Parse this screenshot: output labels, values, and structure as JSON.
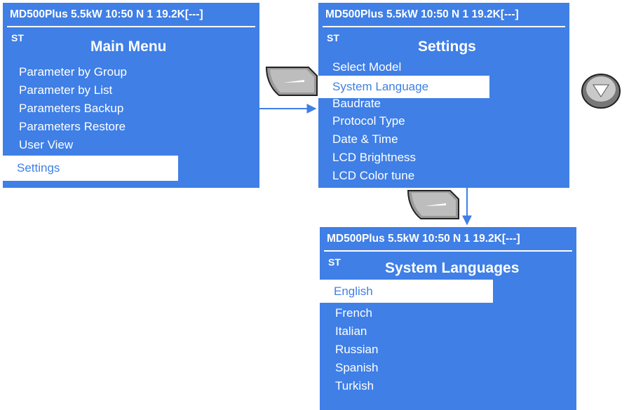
{
  "status_bar": "MD500Plus  5.5kW  10:50  N  1 19.2K[---]",
  "state": "ST",
  "colors": {
    "screen_bg": "#3f7fe6",
    "text": "#ffffff",
    "highlight_bg": "#ffffff",
    "highlight_text": "#3f7fe6"
  },
  "main_menu": {
    "title": "Main Menu",
    "items": [
      "Parameter by Group",
      "Parameter by List",
      "Parameters Backup",
      "Parameters Restore",
      "User View"
    ],
    "selected": "Settings"
  },
  "settings": {
    "title": "Settings",
    "item_top": "Select Model",
    "selected": "System Language",
    "items_below": [
      "Baudrate",
      "Protocol Type",
      "Date & Time",
      "LCD Brightness",
      "LCD Color tune"
    ]
  },
  "languages": {
    "title": "System Languages",
    "selected": "English",
    "items": [
      "French",
      "Italian",
      "Russian",
      "Spanish",
      "Turkish"
    ]
  },
  "icons": {
    "confirm_key": "enter-key-icon",
    "down_key": "down-arrow-key-icon"
  }
}
